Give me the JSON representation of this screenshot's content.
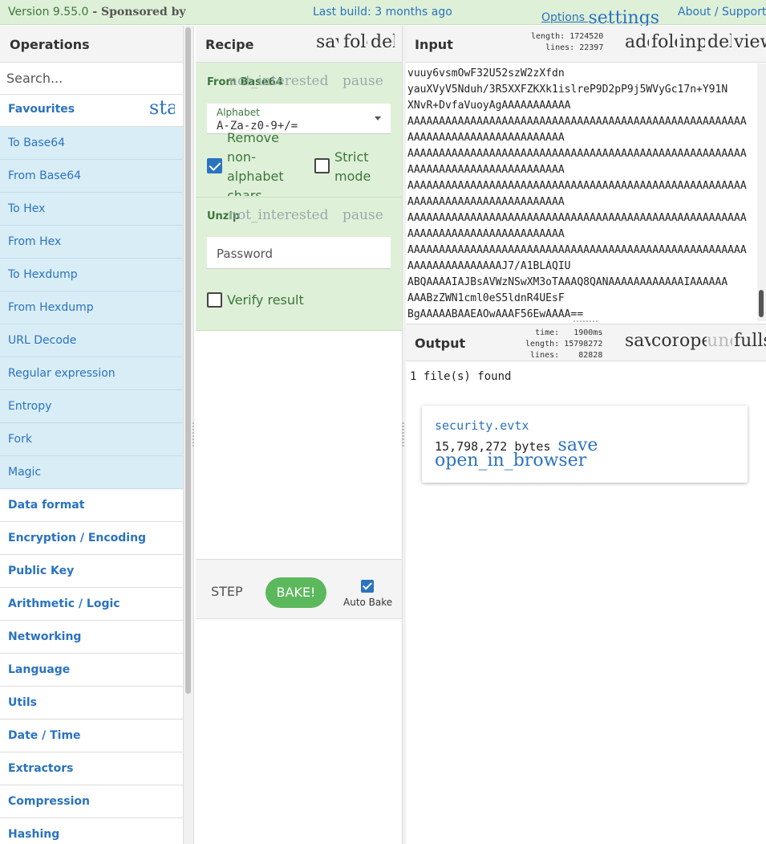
{
  "banner": {
    "version": "Version 9.55.0",
    "sponsored": " - Sponsored by",
    "last_build": "Last build: 3 months ago",
    "options": "Options ",
    "options_icon": "settings",
    "about": "About / Support"
  },
  "operations": {
    "title": "Operations",
    "search_placeholder": "Search...",
    "favourites": "Favourites",
    "favourites_icon": "star",
    "favourite_ops": [
      "To Base64",
      "From Base64",
      "To Hex",
      "From Hex",
      "To Hexdump",
      "From Hexdump",
      "URL Decode",
      "Regular expression",
      "Entropy",
      "Fork",
      "Magic"
    ],
    "categories": [
      "Data format",
      "Encryption / Encoding",
      "Public Key",
      "Arithmetic / Logic",
      "Networking",
      "Language",
      "Utils",
      "Date / Time",
      "Extractors",
      "Compression",
      "Hashing"
    ]
  },
  "recipe": {
    "title": "Recipe",
    "icons": [
      "save",
      "folder",
      "delete"
    ],
    "op1": {
      "name": "From Base64",
      "disable_icon": "not_interested",
      "pause_icon": "pause",
      "alphabet_label": "Alphabet",
      "alphabet_value": "A-Za-z0-9+/=",
      "remove_label": "Remove non-alphabet chars",
      "strict_label": "Strict mode"
    },
    "op2": {
      "name": "Unzip",
      "disable_icon": "not_interested",
      "pause_icon": "pause",
      "password_placeholder": "Password",
      "verify_label": "Verify result"
    },
    "step": "STEP",
    "bake": "BAKE!",
    "auto_bake": "Auto Bake"
  },
  "input": {
    "title": "Input",
    "length_label": "length:",
    "length_value": "1724520",
    "lines_label": "lines:",
    "lines_value": "22397",
    "icons": [
      "add",
      "folder",
      "input",
      "delete",
      "view"
    ],
    "lines": [
      "vuuy6vsmOwF32U52szW2zXfdn",
      "yauXVyV5Nduh/3R5XXFZKXk1islreP9D2pP9j5WVyGc17n+Y91N",
      "XNvR+DvfaVuoyAgAAAAAAAAAAA",
      "AAAAAAAAAAAAAAAAAAAAAAAAAAAAAAAAAAAAAAAAAAAAAAAAAAAAAA",
      "AAAAAAAAAAAAAAAAAAAAAAAAA",
      "AAAAAAAAAAAAAAAAAAAAAAAAAAAAAAAAAAAAAAAAAAAAAAAAAAAAAA",
      "AAAAAAAAAAAAAAAAAAAAAAAAA",
      "AAAAAAAAAAAAAAAAAAAAAAAAAAAAAAAAAAAAAAAAAAAAAAAAAAAAAA",
      "AAAAAAAAAAAAAAAAAAAAAAAAA",
      "AAAAAAAAAAAAAAAAAAAAAAAAAAAAAAAAAAAAAAAAAAAAAAAAAAAAAA",
      "AAAAAAAAAAAAAAAAAAAAAAAAA",
      "AAAAAAAAAAAAAAAAAAAAAAAAAAAAAAAAAAAAAAAAAAAAAAAAAAAAAA",
      "AAAAAAAAAAAAAAAJ7/A1BLAQIU",
      "ABQAAAAIAJBsAVWzNSwXM3oTAAAQ8QANAAAAAAAAAAAAIAAAAAA",
      "AAABzZWN1cml0eS5ldnR4UEsF",
      "BgAAAAABAAEAOwAAAF56EwAAAA=="
    ]
  },
  "output": {
    "title": "Output",
    "time_label": "time:",
    "time_value": "1900ms",
    "length_label": "length:",
    "length_value": "15798272",
    "lines_label": "lines:",
    "lines_value": "82828",
    "icons": [
      "save",
      "content_copy",
      "open_in_browser",
      "undo",
      "fullscreen"
    ],
    "found": "1 file(s) found",
    "file_name": "security.evtx",
    "file_size": "15,798,272 bytes",
    "save_icon": "save",
    "open_icon": "open_in_browser"
  },
  "colors": {
    "accent": "#2a73c0",
    "banner_bg": "#dff0d8",
    "fav_bg": "#d9edf7",
    "bake_green": "#5cb85c"
  }
}
